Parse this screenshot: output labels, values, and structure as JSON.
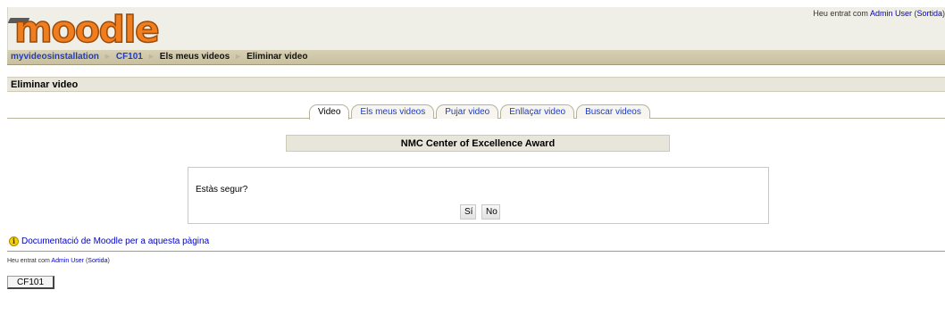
{
  "header": {
    "logo_text": "moodle",
    "login_prefix": "Heu entrat com ",
    "login_user": "Admin User",
    "login_logout": "Sortida"
  },
  "breadcrumb": {
    "items": [
      "myvideosinstallation",
      "CF101",
      "Els meus videos",
      "Eliminar video"
    ],
    "separator": "►"
  },
  "heading": "Eliminar video",
  "tabs": [
    {
      "label": "Video",
      "active": true
    },
    {
      "label": "Els meus videos",
      "active": false
    },
    {
      "label": "Pujar video",
      "active": false
    },
    {
      "label": "Enllaçar video",
      "active": false
    },
    {
      "label": "Buscar videos",
      "active": false
    }
  ],
  "video_title": "NMC Center of Excellence Award",
  "confirm": {
    "message": "Estàs segur?",
    "yes_label": "Sí",
    "no_label": "No"
  },
  "docs": {
    "icon": "info-icon",
    "label": "Documentació de Moodle per a aquesta pàgina"
  },
  "footer": {
    "login_prefix": "Heu entrat com ",
    "login_user": "Admin User",
    "login_logout": "Sortida",
    "course_button": "CF101"
  },
  "colors": {
    "logo_orange": "#f07e1e",
    "link_blue": "#1c3cc8",
    "navbar_bg": "#d7d0b3",
    "info_yellow": "#f5d400"
  }
}
